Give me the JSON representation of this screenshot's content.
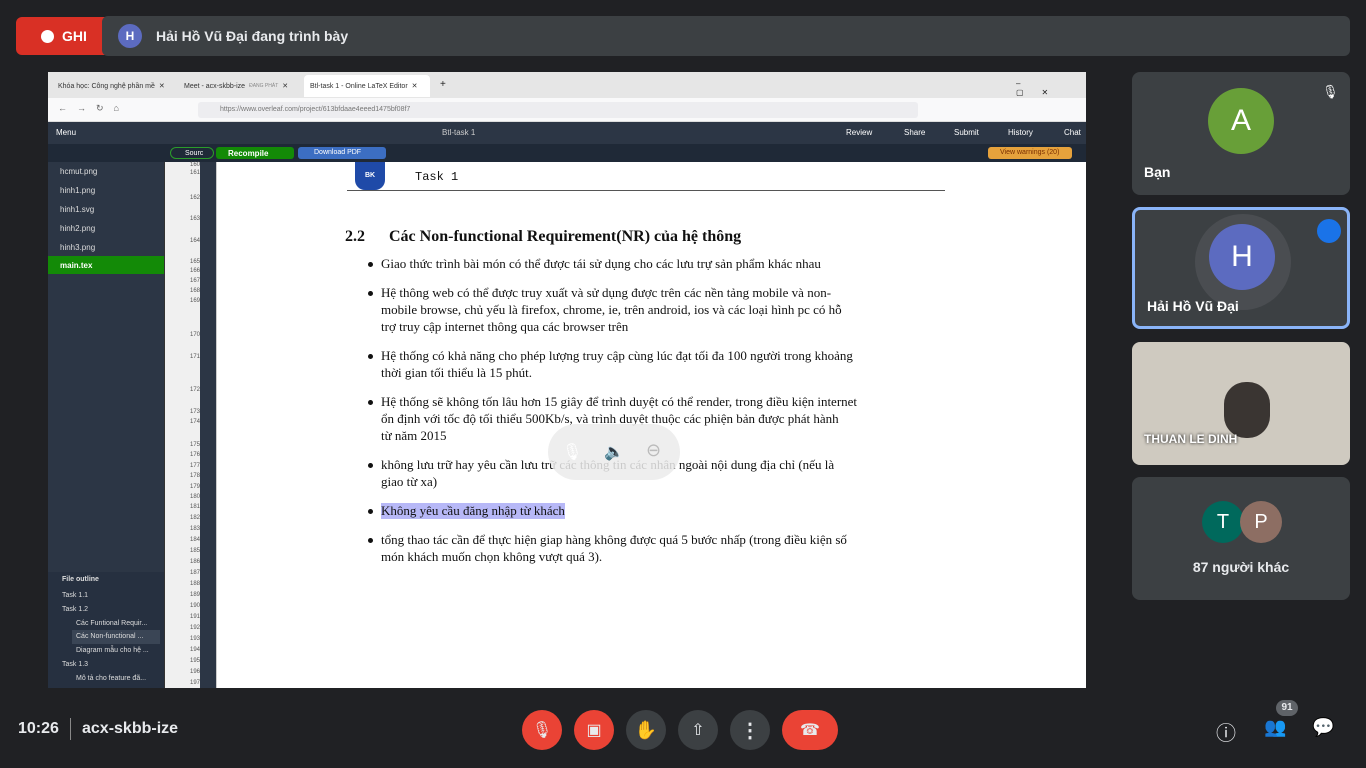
{
  "rec": {
    "label": "GHI"
  },
  "presenter": {
    "initial": "H",
    "text": "Hải Hồ Vũ Đại đang trình bày"
  },
  "browser": {
    "tabs": [
      {
        "label": "Khóa học: Công nghệ phần mề"
      },
      {
        "label": "Meet - acx-skbb-ize",
        "sub": "ĐANG PHÁT"
      },
      {
        "label": "Btl-task 1 - Online LaTeX Editor"
      }
    ],
    "url": "https://www.overleaf.com/project/613bfdaae4eeed1475bf08f7"
  },
  "overleaf": {
    "menu": "Menu",
    "title": "Btl-task 1",
    "review": "Review",
    "share": "Share",
    "submit": "Submit",
    "history": "History",
    "chat": "Chat",
    "source": "Sourc",
    "recompile": "Recompile",
    "download": "Download PDF",
    "warnings": "View warnings (20)",
    "files": [
      "hcmut.png",
      "hinh1.png",
      "hinh1.svg",
      "hinh2.png",
      "hinh3.png",
      "main.tex"
    ],
    "outline_title": "File outline",
    "outline": [
      "Task 1.1",
      "Task 1.2",
      "Các Funtional Requir...",
      "Các Non-functional ...",
      "Diagram mẫu cho hệ ...",
      "Task 1.3",
      "Mô tả cho feature đã..."
    ],
    "line_numbers": [
      "160",
      "161",
      "162",
      "163",
      "164",
      "165",
      "166",
      "167",
      "168",
      "169",
      "170",
      "171",
      "172",
      "173",
      "174",
      "175",
      "176",
      "177",
      "178",
      "179",
      "180",
      "181",
      "182",
      "183",
      "184",
      "185",
      "186",
      "187",
      "188",
      "189",
      "190",
      "191",
      "192",
      "193",
      "194",
      "195",
      "196",
      "197"
    ]
  },
  "doc": {
    "logo": "BK",
    "header": "Task 1",
    "section_num": "2.2",
    "section_title": "Các Non-functional Requirement(NR) của hệ thông",
    "items": [
      [
        "Giao thức trình bài món có thể được tái sử dụng cho các lưu trự sản phẩm khác nhau"
      ],
      [
        "Hệ thông web có thể được truy xuất và sử dụng được trên các nền tảng mobile và non-",
        "mobile browse, chủ yếu là firefox, chrome, ie, trên android, ios và các loại hình pc có hỗ",
        "trợ truy cập internet thông qua các browser trên"
      ],
      [
        "Hệ thống có khả năng cho phép lượng truy cập cùng lúc đạt tối đa 100 người trong khoảng",
        "thời gian tối thiểu là 15 phút."
      ],
      [
        "Hệ thống sẽ không tốn lâu hơn 15 giây để trình duyệt có thể render, trong điều kiện internet",
        "ổn định với tốc độ tối thiểu 500Kb/s, và trình duyệt thuộc các phiện bản được phát hành",
        "từ năm 2015"
      ],
      [
        "không lưu trữ hay yêu cần lưu trữ các thông tin các nhân ngoài nội dung địa chỉ (nếu là",
        "giao từ xa)"
      ],
      [
        "Không yêu cầu đăng nhập từ khách"
      ],
      [
        "tổng thao tác cần để thực hiện giap hàng không được quá 5 bước nhấp (trong điều kiện số",
        "món khách muốn chọn không vượt quá 3)."
      ]
    ]
  },
  "participants": [
    {
      "initial": "A",
      "name": "Bạn",
      "color": "#689f38"
    },
    {
      "initial": "H",
      "name": "Hải Hồ Vũ Đại",
      "color": "#5c6bc0"
    },
    {
      "initial": "",
      "name": "THUAN LE DINH",
      "color": "#cfcac0"
    }
  ],
  "others": {
    "a": "T",
    "b": "P",
    "label": "87 người khác",
    "colorA": "#00695c",
    "colorB": "#8d6e63"
  },
  "bottom": {
    "time": "10:26",
    "meeting": "acx-skbb-ize",
    "people_count": "91"
  }
}
